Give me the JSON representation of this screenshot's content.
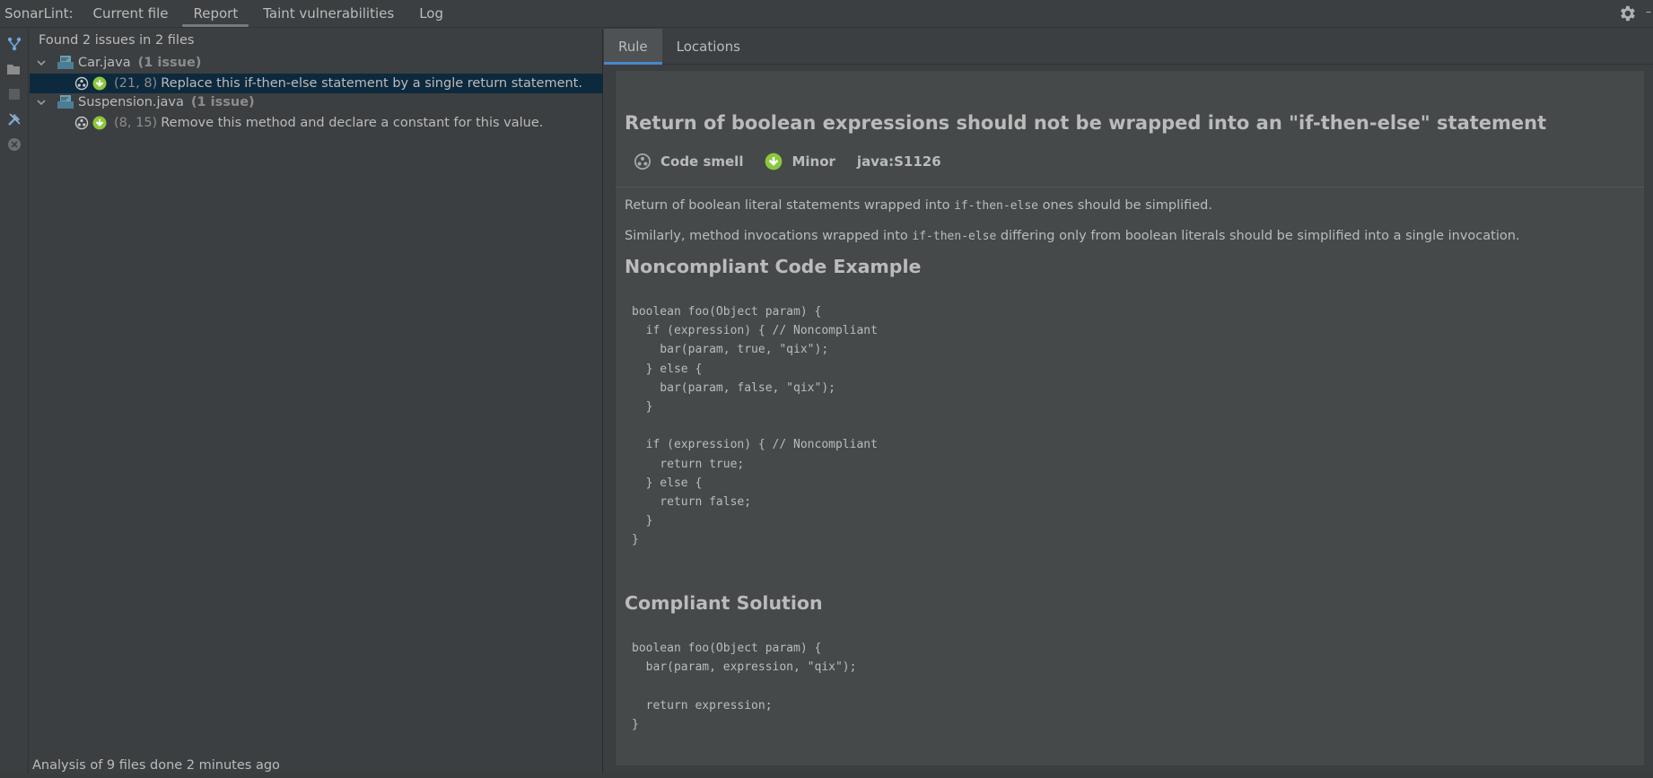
{
  "header": {
    "prefix": "SonarLint:",
    "tabs": [
      "Current file",
      "Report",
      "Taint vulnerabilities",
      "Log"
    ],
    "active_tab": "Report"
  },
  "tree": {
    "summary": "Found 2 issues in 2 files",
    "files": [
      {
        "name": "Car.java",
        "count": "(1 issue)",
        "issues": [
          {
            "location": "(21, 8)",
            "message": "Replace this if-then-else statement by a single return statement.",
            "selected": true
          }
        ]
      },
      {
        "name": "Suspension.java",
        "count": "(1 issue)",
        "issues": [
          {
            "location": "(8, 15)",
            "message": "Remove this method and declare a constant for this value.",
            "selected": false
          }
        ]
      }
    ],
    "footer": "Analysis of 9 files done 2 minutes ago"
  },
  "detail": {
    "tabs": [
      "Rule",
      "Locations"
    ],
    "active_tab": "Rule",
    "title": "Return of boolean expressions should not be wrapped into an \"if-then-else\" statement",
    "type": "Code smell",
    "severity": "Minor",
    "rule_key": "java:S1126",
    "para1_before": "Return of boolean literal statements wrapped into ",
    "para1_code": "if-then-else",
    "para1_after": " ones should be simplified.",
    "para2_before": "Similarly, method invocations wrapped into ",
    "para2_code": "if-then-else",
    "para2_after": " differing only from boolean literals should be simplified into a single invocation.",
    "noncompliant_heading": "Noncompliant Code Example",
    "noncompliant_code": "boolean foo(Object param) {\n  if (expression) { // Noncompliant\n    bar(param, true, \"qix\");\n  } else {\n    bar(param, false, \"qix\");\n  }\n\n  if (expression) { // Noncompliant\n    return true;\n  } else {\n    return false;\n  }\n}",
    "compliant_heading": "Compliant Solution",
    "compliant_code": "boolean foo(Object param) {\n  bar(param, expression, \"qix\");\n\n  return expression;\n}"
  },
  "icons": {
    "gear": "gear-icon",
    "code_smell": "code-smell-icon",
    "minor": "minor-severity-icon"
  },
  "colors": {
    "selected_row": "#0d293e",
    "minor_green": "#8cc63f",
    "active_tab_underline": "#4a88c7"
  }
}
